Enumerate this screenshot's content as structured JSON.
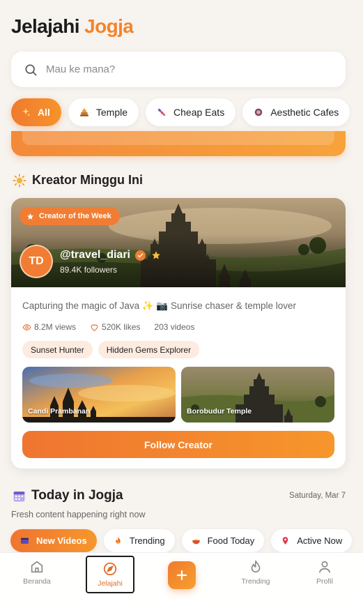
{
  "header": {
    "title_main": "Jelajahi",
    "title_accent": "Jogja"
  },
  "search": {
    "placeholder": "Mau ke mana?",
    "value": ""
  },
  "categories": [
    {
      "label": "All",
      "icon": "sparkles-icon",
      "active": true
    },
    {
      "label": "Temple",
      "icon": "temple-icon",
      "active": false
    },
    {
      "label": "Cheap Eats",
      "icon": "food-icon",
      "active": false
    },
    {
      "label": "Aesthetic Cafes",
      "icon": "cafe-icon",
      "active": false
    }
  ],
  "creators_section": {
    "title": "Kreator Minggu Ini",
    "icon": "sun-icon"
  },
  "creator": {
    "badge": "Creator of the Week",
    "initials": "TD",
    "handle": "@travel_diari",
    "followers": "89.4K followers",
    "bio": "Capturing the magic of Java ✨ 📷 Sunrise chaser & temple lover",
    "stats": {
      "views": "8.2M views",
      "likes": "520K likes",
      "videos": "203 videos"
    },
    "tags": [
      "Sunset Hunter",
      "Hidden Gems Explorer"
    ],
    "thumbnails": [
      {
        "caption": "Candi Prambanan"
      },
      {
        "caption": "Borobudur Temple"
      }
    ],
    "follow_label": "Follow Creator"
  },
  "today": {
    "title": "Today in Jogja",
    "date": "Saturday, Mar 7",
    "subtitle": "Fresh content happening right now",
    "chips": [
      {
        "label": "New Videos",
        "icon": "video-icon",
        "active": true
      },
      {
        "label": "Trending",
        "icon": "fire-icon",
        "active": false
      },
      {
        "label": "Food Today",
        "icon": "bowl-icon",
        "active": false
      },
      {
        "label": "Active Now",
        "icon": "pin-icon",
        "active": false
      }
    ]
  },
  "nav": {
    "home": "Beranda",
    "explore": "Jelajahi",
    "trending": "Trending",
    "profile": "Profil"
  },
  "colors": {
    "accent": "#f5842a",
    "accent_dark": "#ef7530"
  }
}
